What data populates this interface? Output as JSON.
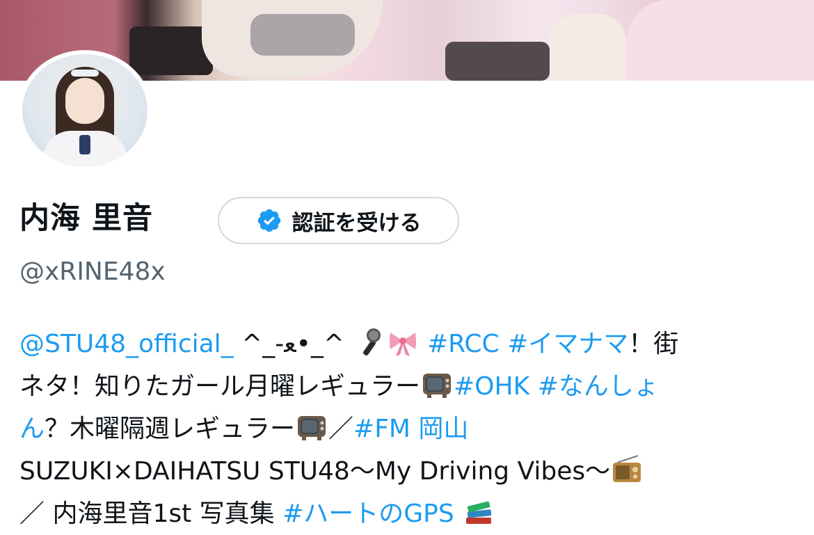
{
  "profile": {
    "display_name": "内海 里音",
    "verify_button_label": "認証を受ける",
    "handle": "@xRINE48x"
  },
  "bio": {
    "line1": {
      "mention": "@STU48_official_",
      "kaomoji": " ^_-ﻌ•_^",
      "tag1": "#RCC",
      "tag2": "#イマナマ",
      "text": "！街"
    },
    "line2": {
      "text": "ネタ！知りたガール月曜レギュラー",
      "tag1": "#OHK",
      "tag2": "#なんしょ"
    },
    "line3": {
      "tag_part": "ん",
      "text": "？木曜隔週レギュラー",
      "separator": "／",
      "tag": "#FM 岡山"
    },
    "line4": {
      "text": "SUZUKI×DAIHATSU STU48〜My Driving Vibes〜"
    },
    "line5": {
      "text_prefix": "／ 内海里音1st 写真集 ",
      "tag": "#ハートのGPS"
    }
  },
  "icons": {
    "verified": "verified-badge-icon",
    "microphone": "microphone-emoji-icon",
    "ribbon": "ribbon-emoji-icon",
    "tv": "tv-emoji-icon",
    "radio": "radio-emoji-icon",
    "books": "books-emoji-icon"
  },
  "colors": {
    "link": "#1d9bf0",
    "text": "#0f1419",
    "secondary": "#536471",
    "border": "#cfd9de"
  }
}
